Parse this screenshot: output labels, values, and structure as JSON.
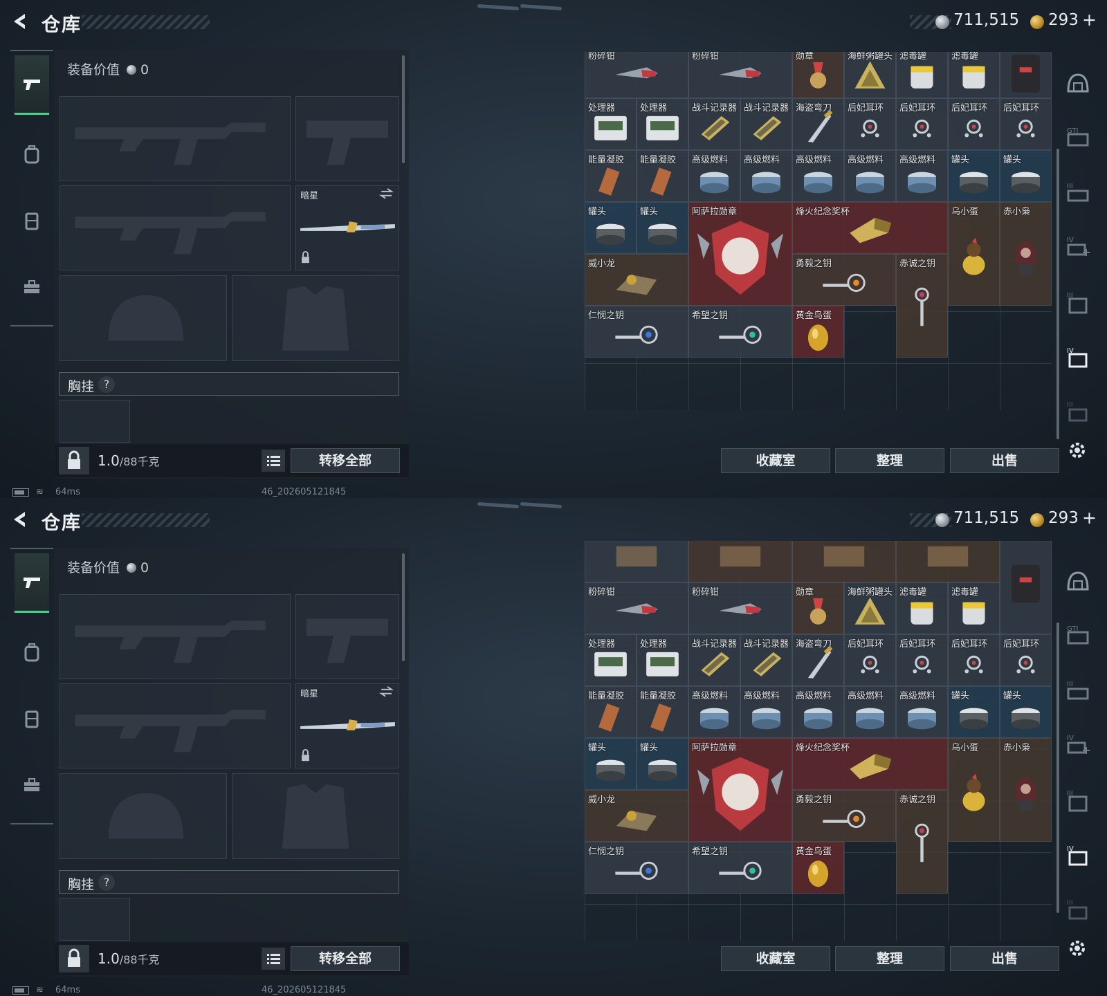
{
  "header": {
    "title": "仓库",
    "silver": "711,515",
    "gold": "293",
    "gold_plus": "+"
  },
  "equipment": {
    "value_label": "装备价值",
    "value": "0",
    "melee_name": "暗星",
    "chest_label": "胸挂",
    "chest_help": "?",
    "weight_current": "1.0",
    "weight_max": "/88千克",
    "transfer_all": "转移全部"
  },
  "stash_buttons": {
    "collection": "收藏室",
    "sort": "整理",
    "sell": "出售"
  },
  "status": {
    "ping": "64ms",
    "build": "46_202605121845"
  },
  "top_stash_items": [
    {
      "label": "粉碎钳",
      "c": 0,
      "r": -1,
      "w": 2,
      "h": 1,
      "tone": "t-grey",
      "icon": "pliers"
    },
    {
      "label": "粉碎钳",
      "c": 2,
      "r": -1,
      "w": 2,
      "h": 1,
      "tone": "t-grey",
      "icon": "pliers"
    },
    {
      "label": "勋章",
      "c": 4,
      "r": -1,
      "w": 1,
      "h": 1,
      "tone": "t-brown",
      "icon": "medal"
    },
    {
      "label": "海鲜粥罐头",
      "c": 5,
      "r": -1,
      "w": 1,
      "h": 1,
      "tone": "t-grey",
      "icon": "triangle"
    },
    {
      "label": "滤毒罐",
      "c": 6,
      "r": -1,
      "w": 1,
      "h": 1,
      "tone": "t-grey",
      "icon": "canister"
    },
    {
      "label": "滤毒罐",
      "c": 7,
      "r": -1,
      "w": 1,
      "h": 1,
      "tone": "t-grey",
      "icon": "canister"
    },
    {
      "label": "",
      "c": 8,
      "r": -1,
      "w": 1,
      "h": 1,
      "tone": "t-grey",
      "icon": "pack"
    },
    {
      "label": "处理器",
      "c": 0,
      "r": 0,
      "w": 1,
      "h": 1,
      "tone": "t-grey",
      "icon": "processor"
    },
    {
      "label": "处理器",
      "c": 1,
      "r": 0,
      "w": 1,
      "h": 1,
      "tone": "t-grey",
      "icon": "processor"
    },
    {
      "label": "战斗记录器",
      "c": 2,
      "r": 0,
      "w": 1,
      "h": 1,
      "tone": "t-grey",
      "icon": "recorder"
    },
    {
      "label": "战斗记录器",
      "c": 3,
      "r": 0,
      "w": 1,
      "h": 1,
      "tone": "t-grey",
      "icon": "recorder"
    },
    {
      "label": "海盗弯刀",
      "c": 4,
      "r": 0,
      "w": 1,
      "h": 1,
      "tone": "t-grey",
      "icon": "blade"
    },
    {
      "label": "后妃耳环",
      "c": 5,
      "r": 0,
      "w": 1,
      "h": 1,
      "tone": "t-grey",
      "icon": "earring"
    },
    {
      "label": "后妃耳环",
      "c": 6,
      "r": 0,
      "w": 1,
      "h": 1,
      "tone": "t-grey",
      "icon": "earring"
    },
    {
      "label": "后妃耳环",
      "c": 7,
      "r": 0,
      "w": 1,
      "h": 1,
      "tone": "t-grey",
      "icon": "earring"
    },
    {
      "label": "后妃耳环",
      "c": 8,
      "r": 0,
      "w": 1,
      "h": 1,
      "tone": "t-grey",
      "icon": "earring"
    },
    {
      "label": "能量凝胶",
      "c": 0,
      "r": 1,
      "w": 1,
      "h": 1,
      "tone": "t-grey",
      "icon": "gel"
    },
    {
      "label": "能量凝胶",
      "c": 1,
      "r": 1,
      "w": 1,
      "h": 1,
      "tone": "t-grey",
      "icon": "gel"
    },
    {
      "label": "高级燃料",
      "c": 2,
      "r": 1,
      "w": 1,
      "h": 1,
      "tone": "t-grey",
      "icon": "fuel"
    },
    {
      "label": "高级燃料",
      "c": 3,
      "r": 1,
      "w": 1,
      "h": 1,
      "tone": "t-grey",
      "icon": "fuel"
    },
    {
      "label": "高级燃料",
      "c": 4,
      "r": 1,
      "w": 1,
      "h": 1,
      "tone": "t-grey",
      "icon": "fuel"
    },
    {
      "label": "高级燃料",
      "c": 5,
      "r": 1,
      "w": 1,
      "h": 1,
      "tone": "t-grey",
      "icon": "fuel"
    },
    {
      "label": "高级燃料",
      "c": 6,
      "r": 1,
      "w": 1,
      "h": 1,
      "tone": "t-grey",
      "icon": "fuel"
    },
    {
      "label": "罐头",
      "c": 7,
      "r": 1,
      "w": 1,
      "h": 1,
      "tone": "t-blue",
      "icon": "can"
    },
    {
      "label": "罐头",
      "c": 8,
      "r": 1,
      "w": 1,
      "h": 1,
      "tone": "t-blue",
      "icon": "can"
    },
    {
      "label": "罐头",
      "c": 0,
      "r": 2,
      "w": 1,
      "h": 1,
      "tone": "t-blue",
      "icon": "can"
    },
    {
      "label": "罐头",
      "c": 1,
      "r": 2,
      "w": 1,
      "h": 1,
      "tone": "t-blue",
      "icon": "can"
    },
    {
      "label": "阿萨拉勋章",
      "c": 2,
      "r": 2,
      "w": 2,
      "h": 2,
      "tone": "t-red",
      "icon": "emblem"
    },
    {
      "label": "烽火纪念奖杯",
      "c": 4,
      "r": 2,
      "w": 3,
      "h": 1,
      "tone": "t-red",
      "icon": "trophy"
    },
    {
      "label": "乌小蛋",
      "c": 7,
      "r": 2,
      "w": 1,
      "h": 2,
      "tone": "t-brown",
      "icon": "figure-bird"
    },
    {
      "label": "赤小枭",
      "c": 8,
      "r": 2,
      "w": 1,
      "h": 2,
      "tone": "t-brown",
      "icon": "figure-hood"
    },
    {
      "label": "威小龙",
      "c": 0,
      "r": 3,
      "w": 2,
      "h": 1,
      "tone": "t-brown",
      "icon": "figure-dragon"
    },
    {
      "label": "勇毅之钥",
      "c": 4,
      "r": 3,
      "w": 2,
      "h": 1,
      "tone": "t-brown",
      "icon": "key-orange"
    },
    {
      "label": "赤诚之钥",
      "c": 6,
      "r": 3,
      "w": 1,
      "h": 2,
      "tone": "t-brown",
      "icon": "key-vertical"
    },
    {
      "label": "仁悯之钥",
      "c": 0,
      "r": 4,
      "w": 2,
      "h": 1,
      "tone": "t-grey",
      "icon": "key-blue"
    },
    {
      "label": "希望之钥",
      "c": 2,
      "r": 4,
      "w": 2,
      "h": 1,
      "tone": "t-grey",
      "icon": "key-teal"
    },
    {
      "label": "黄金鸟蛋",
      "c": 4,
      "r": 4,
      "w": 1,
      "h": 1,
      "tone": "t-red",
      "icon": "egg"
    }
  ],
  "bottom_stash_items": [
    {
      "label": "",
      "c": 0,
      "r": -1,
      "w": 2,
      "h": 1,
      "tone": "t-grey",
      "icon": "partial"
    },
    {
      "label": "",
      "c": 2,
      "r": -1,
      "w": 2,
      "h": 1,
      "tone": "t-brown",
      "icon": "partial"
    },
    {
      "label": "",
      "c": 4,
      "r": -1,
      "w": 2,
      "h": 1,
      "tone": "t-brown",
      "icon": "partial"
    },
    {
      "label": "",
      "c": 6,
      "r": -1,
      "w": 2,
      "h": 1,
      "tone": "t-brown",
      "icon": "partial"
    },
    {
      "label": "粉碎钳",
      "c": 0,
      "r": 0,
      "w": 2,
      "h": 1,
      "tone": "t-grey",
      "icon": "pliers"
    },
    {
      "label": "粉碎钳",
      "c": 2,
      "r": 0,
      "w": 2,
      "h": 1,
      "tone": "t-grey",
      "icon": "pliers"
    },
    {
      "label": "勋章",
      "c": 4,
      "r": 0,
      "w": 1,
      "h": 1,
      "tone": "t-brown",
      "icon": "medal"
    },
    {
      "label": "海鲜粥罐头",
      "c": 5,
      "r": 0,
      "w": 1,
      "h": 1,
      "tone": "t-grey",
      "icon": "triangle"
    },
    {
      "label": "滤毒罐",
      "c": 6,
      "r": 0,
      "w": 1,
      "h": 1,
      "tone": "t-grey",
      "icon": "canister"
    },
    {
      "label": "滤毒罐",
      "c": 7,
      "r": 0,
      "w": 1,
      "h": 1,
      "tone": "t-grey",
      "icon": "canister"
    },
    {
      "label": "",
      "c": 8,
      "r": -1,
      "w": 1,
      "h": 2,
      "tone": "t-grey",
      "icon": "pack"
    },
    {
      "label": "处理器",
      "c": 0,
      "r": 1,
      "w": 1,
      "h": 1,
      "tone": "t-grey",
      "icon": "processor"
    },
    {
      "label": "处理器",
      "c": 1,
      "r": 1,
      "w": 1,
      "h": 1,
      "tone": "t-grey",
      "icon": "processor"
    },
    {
      "label": "战斗记录器",
      "c": 2,
      "r": 1,
      "w": 1,
      "h": 1,
      "tone": "t-grey",
      "icon": "recorder"
    },
    {
      "label": "战斗记录器",
      "c": 3,
      "r": 1,
      "w": 1,
      "h": 1,
      "tone": "t-grey",
      "icon": "recorder"
    },
    {
      "label": "海盗弯刀",
      "c": 4,
      "r": 1,
      "w": 1,
      "h": 1,
      "tone": "t-grey",
      "icon": "blade"
    },
    {
      "label": "后妃耳环",
      "c": 5,
      "r": 1,
      "w": 1,
      "h": 1,
      "tone": "t-grey",
      "icon": "earring"
    },
    {
      "label": "后妃耳环",
      "c": 6,
      "r": 1,
      "w": 1,
      "h": 1,
      "tone": "t-grey",
      "icon": "earring"
    },
    {
      "label": "后妃耳环",
      "c": 7,
      "r": 1,
      "w": 1,
      "h": 1,
      "tone": "t-grey",
      "icon": "earring"
    },
    {
      "label": "后妃耳环",
      "c": 8,
      "r": 1,
      "w": 1,
      "h": 1,
      "tone": "t-grey",
      "icon": "earring"
    },
    {
      "label": "能量凝胶",
      "c": 0,
      "r": 2,
      "w": 1,
      "h": 1,
      "tone": "t-grey",
      "icon": "gel"
    },
    {
      "label": "能量凝胶",
      "c": 1,
      "r": 2,
      "w": 1,
      "h": 1,
      "tone": "t-grey",
      "icon": "gel"
    },
    {
      "label": "高级燃料",
      "c": 2,
      "r": 2,
      "w": 1,
      "h": 1,
      "tone": "t-grey",
      "icon": "fuel"
    },
    {
      "label": "高级燃料",
      "c": 3,
      "r": 2,
      "w": 1,
      "h": 1,
      "tone": "t-grey",
      "icon": "fuel"
    },
    {
      "label": "高级燃料",
      "c": 4,
      "r": 2,
      "w": 1,
      "h": 1,
      "tone": "t-grey",
      "icon": "fuel"
    },
    {
      "label": "高级燃料",
      "c": 5,
      "r": 2,
      "w": 1,
      "h": 1,
      "tone": "t-grey",
      "icon": "fuel"
    },
    {
      "label": "高级燃料",
      "c": 6,
      "r": 2,
      "w": 1,
      "h": 1,
      "tone": "t-grey",
      "icon": "fuel"
    },
    {
      "label": "罐头",
      "c": 7,
      "r": 2,
      "w": 1,
      "h": 1,
      "tone": "t-blue",
      "icon": "can"
    },
    {
      "label": "罐头",
      "c": 8,
      "r": 2,
      "w": 1,
      "h": 1,
      "tone": "t-blue",
      "icon": "can"
    },
    {
      "label": "罐头",
      "c": 0,
      "r": 3,
      "w": 1,
      "h": 1,
      "tone": "t-blue",
      "icon": "can"
    },
    {
      "label": "罐头",
      "c": 1,
      "r": 3,
      "w": 1,
      "h": 1,
      "tone": "t-blue",
      "icon": "can"
    },
    {
      "label": "阿萨拉勋章",
      "c": 2,
      "r": 3,
      "w": 2,
      "h": 2,
      "tone": "t-red",
      "icon": "emblem"
    },
    {
      "label": "烽火纪念奖杯",
      "c": 4,
      "r": 3,
      "w": 3,
      "h": 1,
      "tone": "t-red",
      "icon": "trophy"
    },
    {
      "label": "乌小蛋",
      "c": 7,
      "r": 3,
      "w": 1,
      "h": 2,
      "tone": "t-brown",
      "icon": "figure-bird"
    },
    {
      "label": "赤小枭",
      "c": 8,
      "r": 3,
      "w": 1,
      "h": 2,
      "tone": "t-brown",
      "icon": "figure-hood"
    },
    {
      "label": "威小龙",
      "c": 0,
      "r": 4,
      "w": 2,
      "h": 1,
      "tone": "t-brown",
      "icon": "figure-dragon"
    },
    {
      "label": "勇毅之钥",
      "c": 4,
      "r": 4,
      "w": 2,
      "h": 1,
      "tone": "t-brown",
      "icon": "key-orange"
    },
    {
      "label": "赤诚之钥",
      "c": 6,
      "r": 4,
      "w": 1,
      "h": 2,
      "tone": "t-brown",
      "icon": "key-vertical"
    },
    {
      "label": "仁悯之钥",
      "c": 0,
      "r": 5,
      "w": 2,
      "h": 1,
      "tone": "t-grey",
      "icon": "key-blue"
    },
    {
      "label": "希望之钥",
      "c": 2,
      "r": 5,
      "w": 2,
      "h": 1,
      "tone": "t-grey",
      "icon": "key-teal"
    },
    {
      "label": "黄金鸟蛋",
      "c": 4,
      "r": 5,
      "w": 1,
      "h": 1,
      "tone": "t-red",
      "icon": "egg"
    }
  ],
  "rail_icons": [
    "helmet-tier-icon",
    "armor-gti-icon",
    "armor-tier3-icon",
    "armor-tier4-icon",
    "rig-tier3-icon",
    "rig-tier4-icon",
    "backpack-tier3-icon"
  ]
}
